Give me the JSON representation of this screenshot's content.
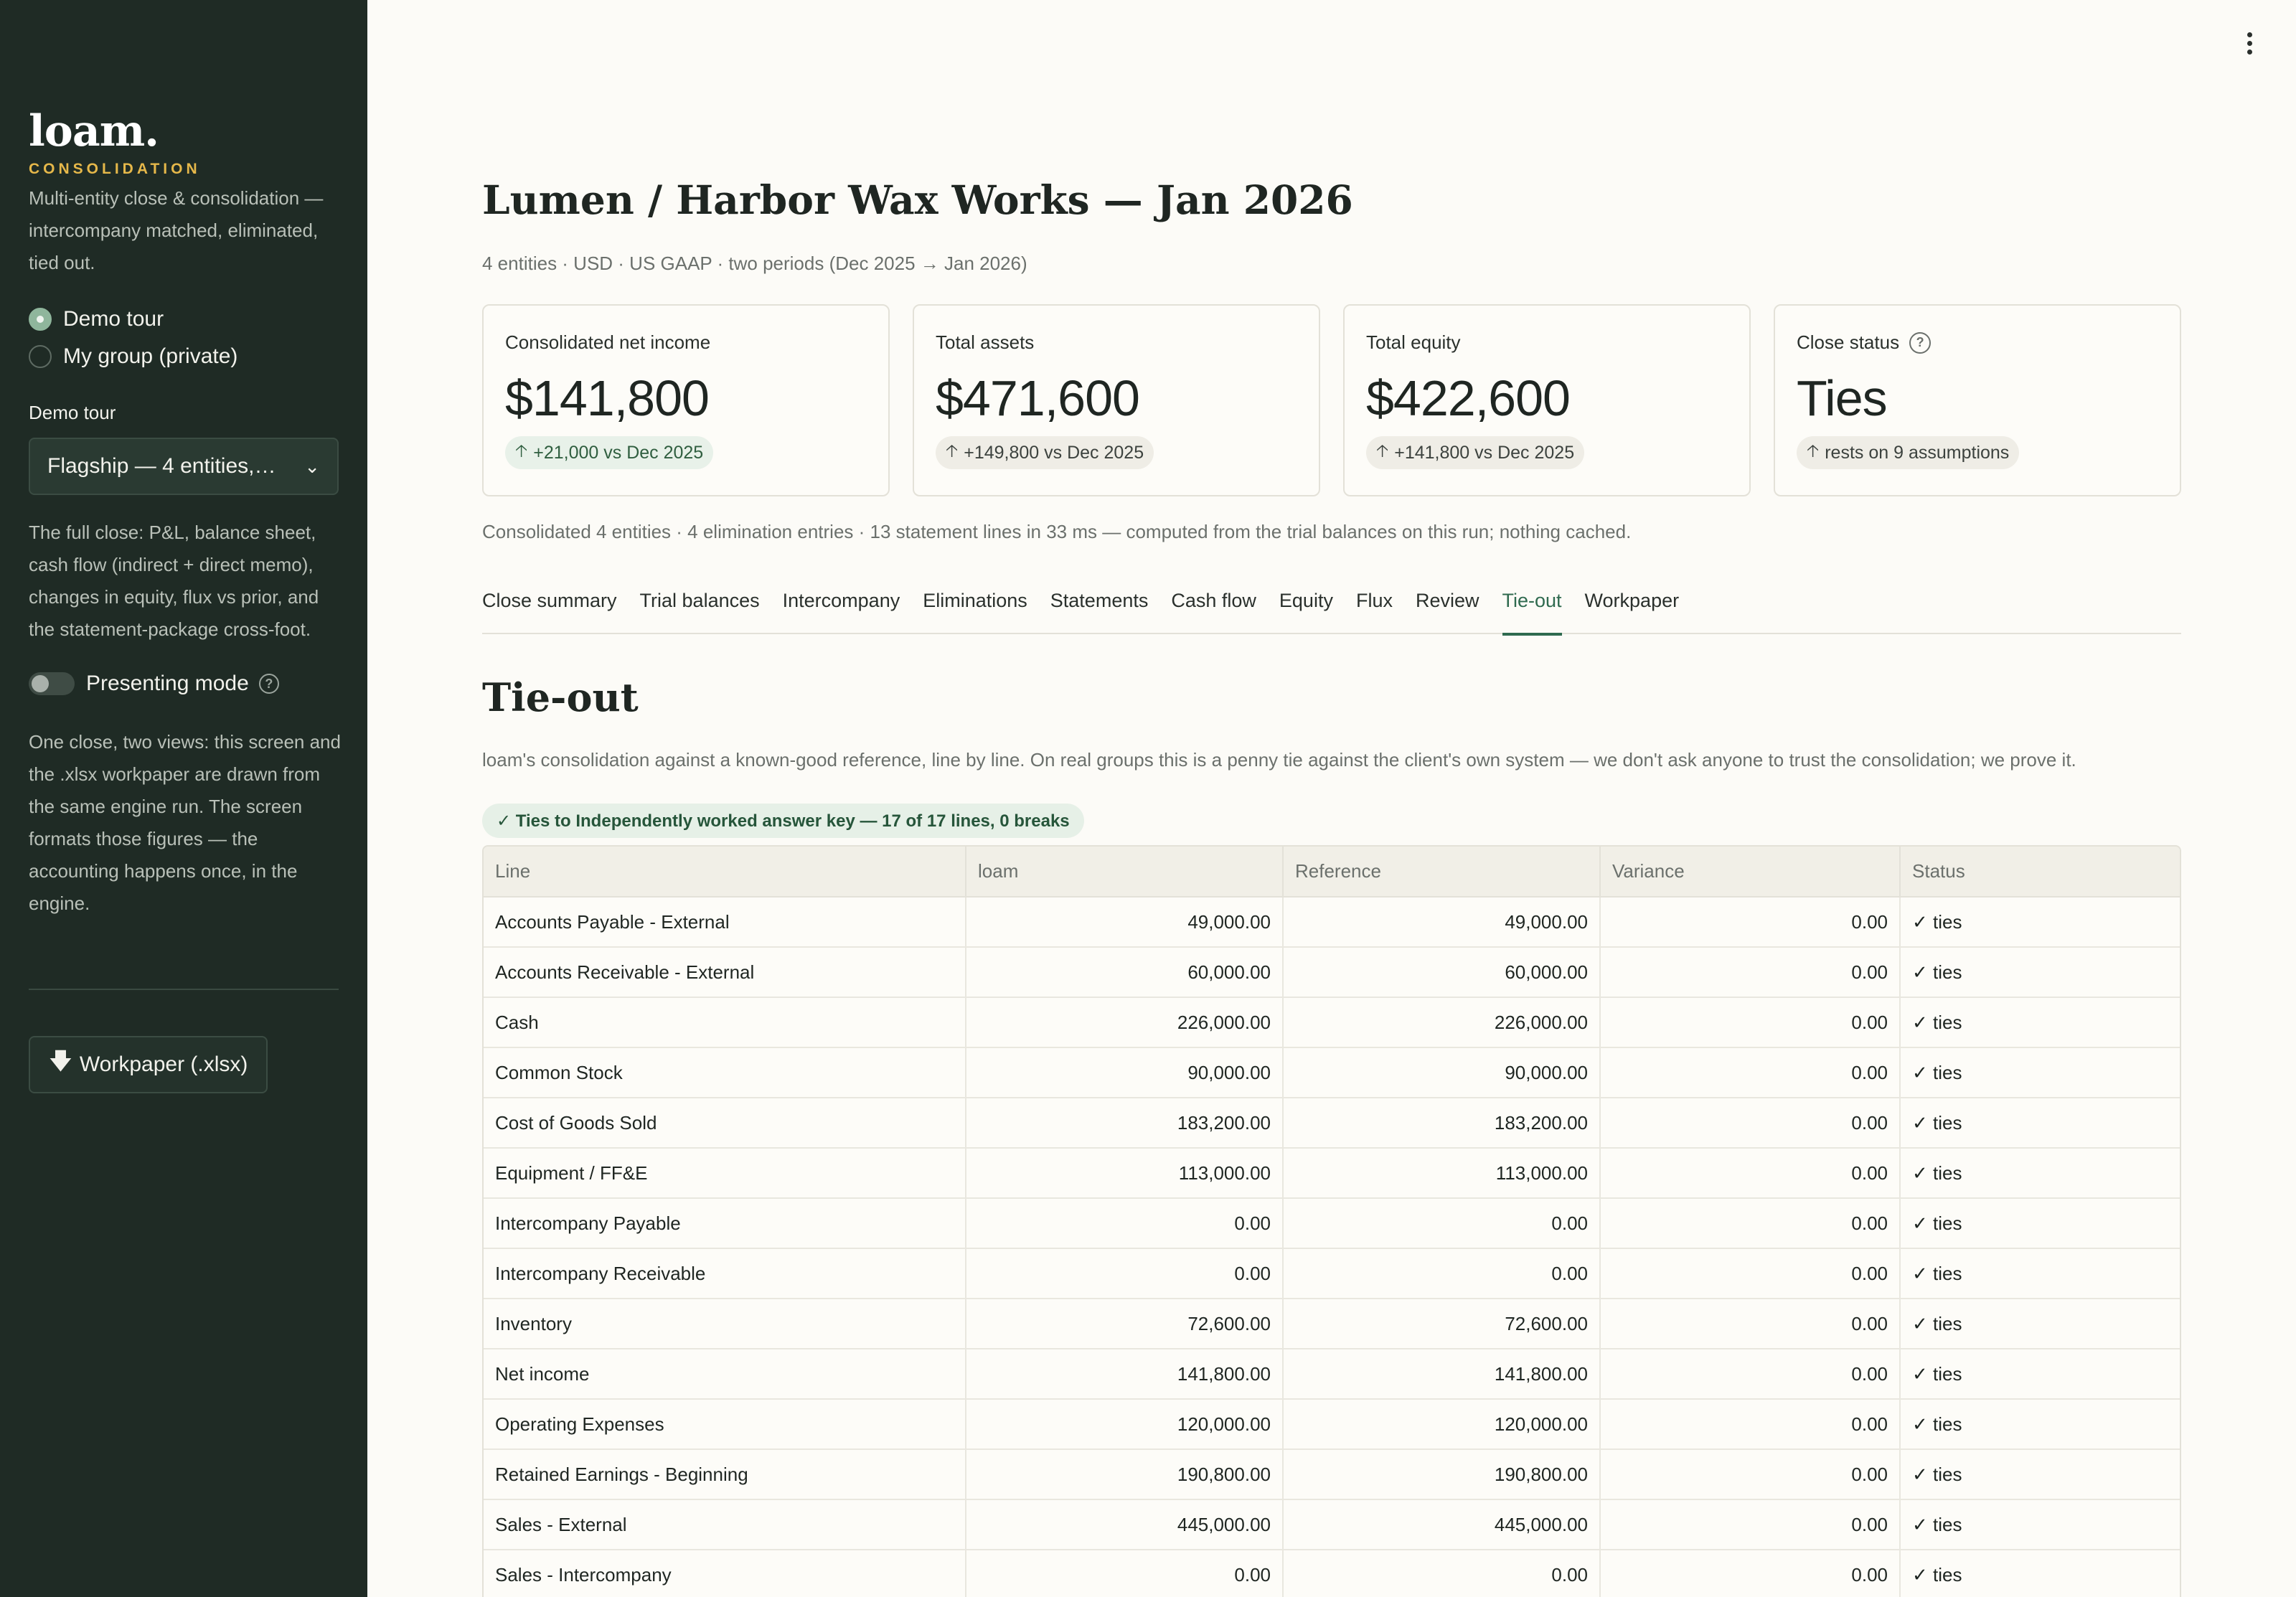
{
  "sidebar": {
    "brand": "loam.",
    "brand_sub": "CONSOLIDATION",
    "brand_desc": "Multi-entity close & consolidation — intercompany matched, eliminated, tied out.",
    "radio_options": [
      {
        "label": "Demo tour",
        "selected": true
      },
      {
        "label": "My group (private)",
        "selected": false
      }
    ],
    "demo_label": "Demo tour",
    "demo_select_value": "Flagship — 4 entities,…",
    "demo_desc": "The full close: P&L, balance sheet, cash flow (indirect + direct memo), changes in equity, flux vs prior, and the statement-package cross-foot.",
    "presenting_label": "Presenting mode",
    "presenting_on": false,
    "views_desc": "One close, two views: this screen and the .xlsx workpaper are drawn from the same engine run. The screen formats those figures — the accounting happens once, in the engine.",
    "download_label": "Workpaper (.xlsx)"
  },
  "header": {
    "title": "Lumen / Harbor Wax Works — Jan 2026",
    "subtitle": "4 entities · USD · US GAAP · two periods (Dec 2025 → Jan 2026)"
  },
  "cards": [
    {
      "label": "Consolidated net income",
      "value": "$141,800",
      "delta": "+21,000 vs Dec 2025",
      "tone": "positive"
    },
    {
      "label": "Total assets",
      "value": "$471,600",
      "delta": "+149,800 vs Dec 2025",
      "tone": "neutral"
    },
    {
      "label": "Total equity",
      "value": "$422,600",
      "delta": "+141,800 vs Dec 2025",
      "tone": "neutral"
    },
    {
      "label": "Close status",
      "value": "Ties",
      "delta": "rests on 9 assumptions",
      "tone": "neutral",
      "help": true
    }
  ],
  "note": "Consolidated 4 entities · 4 elimination entries · 13 statement lines in 33 ms — computed from the trial balances on this run; nothing cached.",
  "tabs": [
    {
      "label": "Close summary",
      "active": false
    },
    {
      "label": "Trial balances",
      "active": false
    },
    {
      "label": "Intercompany",
      "active": false
    },
    {
      "label": "Eliminations",
      "active": false
    },
    {
      "label": "Statements",
      "active": false
    },
    {
      "label": "Cash flow",
      "active": false
    },
    {
      "label": "Equity",
      "active": false
    },
    {
      "label": "Flux",
      "active": false
    },
    {
      "label": "Review",
      "active": false
    },
    {
      "label": "Tie-out",
      "active": true
    },
    {
      "label": "Workpaper",
      "active": false
    }
  ],
  "section": {
    "title": "Tie-out",
    "desc": "loam's consolidation against a known-good reference, line by line. On real groups this is a penny tie against the client's own system — we don't ask anyone to trust the consolidation; we prove it.",
    "badge": "✓ Ties to Independently worked answer key — 17 of 17 lines, 0 breaks"
  },
  "table": {
    "columns": [
      "Line",
      "loam",
      "Reference",
      "Variance",
      "Status"
    ],
    "rows": [
      [
        "Accounts Payable - External",
        "49,000.00",
        "49,000.00",
        "0.00",
        "✓ ties"
      ],
      [
        "Accounts Receivable - External",
        "60,000.00",
        "60,000.00",
        "0.00",
        "✓ ties"
      ],
      [
        "Cash",
        "226,000.00",
        "226,000.00",
        "0.00",
        "✓ ties"
      ],
      [
        "Common Stock",
        "90,000.00",
        "90,000.00",
        "0.00",
        "✓ ties"
      ],
      [
        "Cost of Goods Sold",
        "183,200.00",
        "183,200.00",
        "0.00",
        "✓ ties"
      ],
      [
        "Equipment / FF&E",
        "113,000.00",
        "113,000.00",
        "0.00",
        "✓ ties"
      ],
      [
        "Intercompany Payable",
        "0.00",
        "0.00",
        "0.00",
        "✓ ties"
      ],
      [
        "Intercompany Receivable",
        "0.00",
        "0.00",
        "0.00",
        "✓ ties"
      ],
      [
        "Inventory",
        "72,600.00",
        "72,600.00",
        "0.00",
        "✓ ties"
      ],
      [
        "Net income",
        "141,800.00",
        "141,800.00",
        "0.00",
        "✓ ties"
      ],
      [
        "Operating Expenses",
        "120,000.00",
        "120,000.00",
        "0.00",
        "✓ ties"
      ],
      [
        "Retained Earnings - Beginning",
        "190,800.00",
        "190,800.00",
        "0.00",
        "✓ ties"
      ],
      [
        "Sales - External",
        "445,000.00",
        "445,000.00",
        "0.00",
        "✓ ties"
      ],
      [
        "Sales - Intercompany",
        "0.00",
        "0.00",
        "0.00",
        "✓ ties"
      ]
    ]
  },
  "icons": {
    "menu": "kebab-menu-icon",
    "help": "question-circle-icon",
    "chevron": "chevron-down-icon",
    "download": "download-arrow-icon",
    "delta": "arrow-up-icon"
  },
  "colors": {
    "sidebar_bg": "#1f2b25",
    "accent": "#2f6a4f",
    "brand_sub": "#e6b84a",
    "positive_pill": "#e8f1e9"
  }
}
